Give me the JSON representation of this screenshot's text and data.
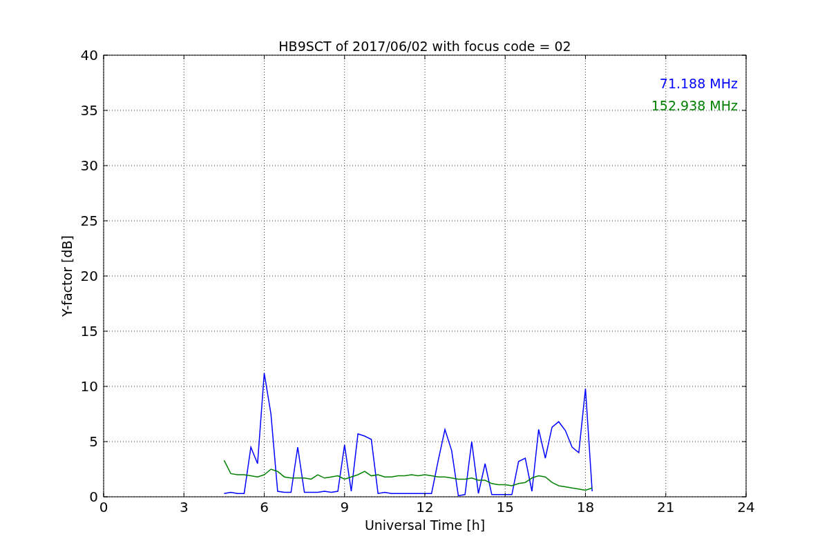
{
  "chart_data": {
    "type": "line",
    "title": "HB9SCT of 2017/06/02 with focus code = 02",
    "xlabel": "Universal Time [h]",
    "ylabel": "Y-factor [dB]",
    "x": [
      4.5,
      4.75,
      5.0,
      5.25,
      5.5,
      5.75,
      6.0,
      6.25,
      6.5,
      6.75,
      7.0,
      7.25,
      7.5,
      7.75,
      8.0,
      8.25,
      8.5,
      8.75,
      9.0,
      9.25,
      9.5,
      9.75,
      10.0,
      10.25,
      10.5,
      10.75,
      11.0,
      11.25,
      11.5,
      11.75,
      12.0,
      12.25,
      12.5,
      12.75,
      13.0,
      13.25,
      13.5,
      13.75,
      14.0,
      14.25,
      14.5,
      14.75,
      15.0,
      15.25,
      15.5,
      15.75,
      16.0,
      16.25,
      16.5,
      16.75,
      17.0,
      17.25,
      17.5,
      17.75,
      18.0,
      18.25
    ],
    "series": [
      {
        "name": "71.188 MHz",
        "color": "#0000ff",
        "values": [
          0.3,
          0.4,
          0.3,
          0.3,
          4.5,
          3.0,
          11.2,
          7.5,
          0.5,
          0.4,
          0.4,
          4.5,
          0.4,
          0.4,
          0.4,
          0.5,
          0.4,
          0.5,
          4.7,
          0.5,
          5.7,
          5.5,
          5.2,
          0.3,
          0.4,
          0.3,
          0.3,
          0.3,
          0.3,
          0.3,
          0.3,
          0.3,
          3.3,
          6.1,
          4.2,
          0.1,
          0.2,
          5.0,
          0.3,
          3.0,
          0.2,
          0.2,
          0.2,
          0.2,
          3.2,
          3.5,
          0.5,
          6.1,
          3.5,
          6.3,
          6.8,
          6.0,
          4.5,
          4.0,
          9.8,
          0.5
        ]
      },
      {
        "name": "152.938 MHz",
        "color": "#008000",
        "values": [
          3.3,
          2.1,
          2.0,
          2.0,
          1.9,
          1.8,
          2.0,
          2.5,
          2.3,
          1.8,
          1.7,
          1.7,
          1.7,
          1.6,
          2.0,
          1.7,
          1.8,
          1.9,
          1.6,
          1.8,
          2.0,
          2.3,
          1.9,
          2.0,
          1.8,
          1.8,
          1.9,
          1.9,
          2.0,
          1.9,
          2.0,
          1.9,
          1.8,
          1.8,
          1.7,
          1.6,
          1.6,
          1.7,
          1.5,
          1.5,
          1.2,
          1.1,
          1.1,
          1.0,
          1.2,
          1.3,
          1.7,
          1.9,
          1.8,
          1.3,
          1.0,
          0.9,
          0.8,
          0.7,
          0.6,
          0.8
        ]
      }
    ],
    "xlim": [
      0,
      24
    ],
    "ylim": [
      0,
      40
    ],
    "xticks": [
      0,
      3,
      6,
      9,
      12,
      15,
      18,
      21,
      24
    ],
    "yticks": [
      0,
      5,
      10,
      15,
      20,
      25,
      30,
      35,
      40
    ],
    "grid": true
  }
}
